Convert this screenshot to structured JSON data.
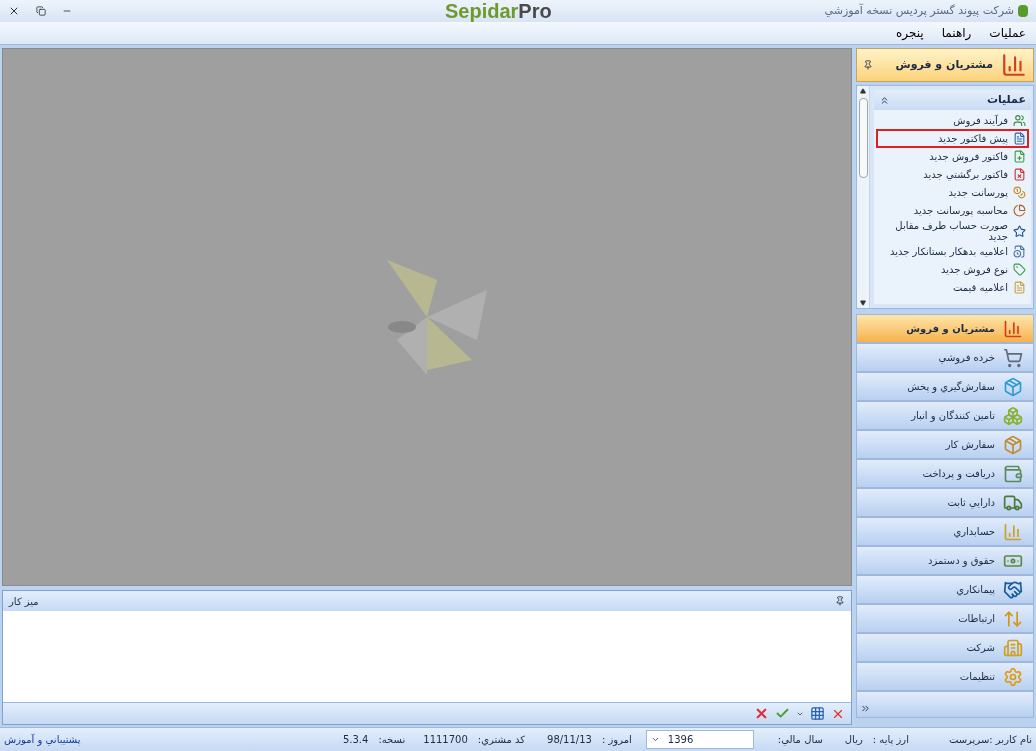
{
  "window": {
    "title": "شرکت پیوند گستر پردیس نسخه آموزشي",
    "logo": {
      "first": "Sepidar",
      "second": "Pro"
    }
  },
  "menu": [
    "عمليات",
    "راهنما",
    "پنجره"
  ],
  "sidebar": {
    "header": "مشتريان و فروش",
    "group": {
      "title": "عمليات",
      "expanded": true,
      "items": [
        {
          "label": "فرآیند فروش",
          "marked": false
        },
        {
          "label": "پيش فاكتور جديد",
          "marked": true
        },
        {
          "label": "فاكتور فروش جديد",
          "marked": false
        },
        {
          "label": "فاكتور برگشتي جديد",
          "marked": false
        },
        {
          "label": "پورسانت جديد",
          "marked": false
        },
        {
          "label": "محاسبه پورسانت جديد",
          "marked": false
        },
        {
          "label": "صورت حساب طرف مقابل جديد",
          "marked": false
        },
        {
          "label": "اعلاميه بدهكار بستانكار جديد",
          "marked": false
        },
        {
          "label": "نوع فروش جديد",
          "marked": false
        },
        {
          "label": "اعلاميه قيمت",
          "marked": false
        }
      ]
    },
    "nav": [
      {
        "label": "مشتريان و فروش",
        "selected": true
      },
      {
        "label": "خرده فروشي",
        "selected": false
      },
      {
        "label": "سفارش‌گيري و پخش",
        "selected": false
      },
      {
        "label": "تامين كنندگان و انبار",
        "selected": false
      },
      {
        "label": "سفارش كار",
        "selected": false
      },
      {
        "label": "دريافت و پرداخت",
        "selected": false
      },
      {
        "label": "دارايي ثابت",
        "selected": false
      },
      {
        "label": "حسابداري",
        "selected": false
      },
      {
        "label": "حقوق و دستمزد",
        "selected": false
      },
      {
        "label": "پيمانكاري",
        "selected": false
      },
      {
        "label": "ارتباطات",
        "selected": false
      },
      {
        "label": "شركت",
        "selected": false
      },
      {
        "label": "تنظيمات",
        "selected": false
      }
    ]
  },
  "desk": {
    "title": "ميز كار"
  },
  "status_bar": {
    "user": "نام كاربر :سرپرست",
    "currency_label": "ارز پايه :",
    "currency": "ريال",
    "year_label": "سال مالي:",
    "year": "1396",
    "today_label": "امروز :",
    "today": "98/11/13",
    "customer_label": "كد مشتري:",
    "customer": "1111700",
    "version_label": "نسخه:",
    "version": "5.3.4",
    "support_link": "پشتيباني و آموزش"
  }
}
